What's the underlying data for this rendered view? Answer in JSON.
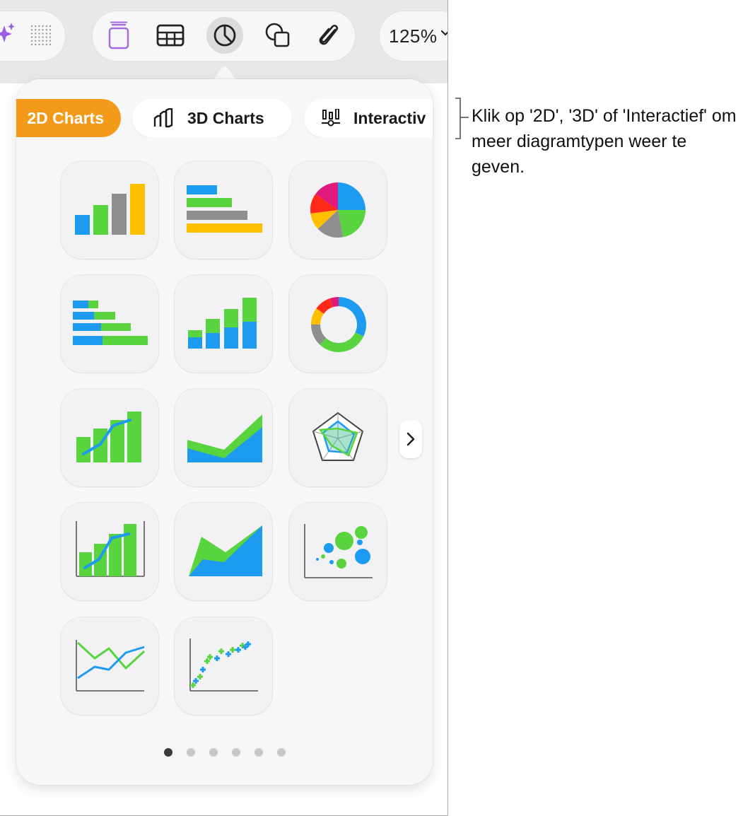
{
  "toolbar": {
    "left_icons": [
      "sparkle-icon",
      "dot-grid-icon"
    ],
    "center_icons": [
      "text-box-icon",
      "table-icon",
      "chart-icon",
      "shape-icon",
      "paperclip-icon"
    ],
    "active_icon": "chart-icon",
    "zoom_value": "125%",
    "colors": {
      "bar_bg": "#e8e8ea",
      "pill_bg": "#f7f7f8",
      "text_icon_accent": "#a56be0"
    }
  },
  "popover": {
    "tabs": [
      {
        "label": "2D Charts",
        "selected": true
      },
      {
        "label": "3D Charts",
        "selected": false,
        "icon": "3d-bar-chart-icon"
      },
      {
        "label": "Interactiv",
        "selected": false,
        "icon": "interactive-chart-icon"
      }
    ],
    "selected_tab_color": "#f39a1b",
    "chart_types": [
      "column-chart",
      "bar-chart",
      "pie-chart",
      "stacked-bar-chart",
      "stacked-column-chart",
      "donut-chart",
      "mixed-column-line-chart",
      "area-chart",
      "radar-chart",
      "two-axis-chart",
      "stacked-area-chart",
      "bubble-chart",
      "line-chart",
      "scatter-chart"
    ],
    "next_button_icon": "chevron-right-icon",
    "page_count": 6,
    "current_page": 1,
    "series_colors": {
      "blue": "#1d9bf0",
      "green": "#59d43f",
      "gray": "#8e8e8e",
      "yellow": "#ffbf00",
      "red": "#ff2a1a",
      "magenta": "#e0197d"
    }
  },
  "callout": {
    "text": "Klik op '2D', '3D' of 'Interactief' om meer diagramtypen weer te geven."
  }
}
